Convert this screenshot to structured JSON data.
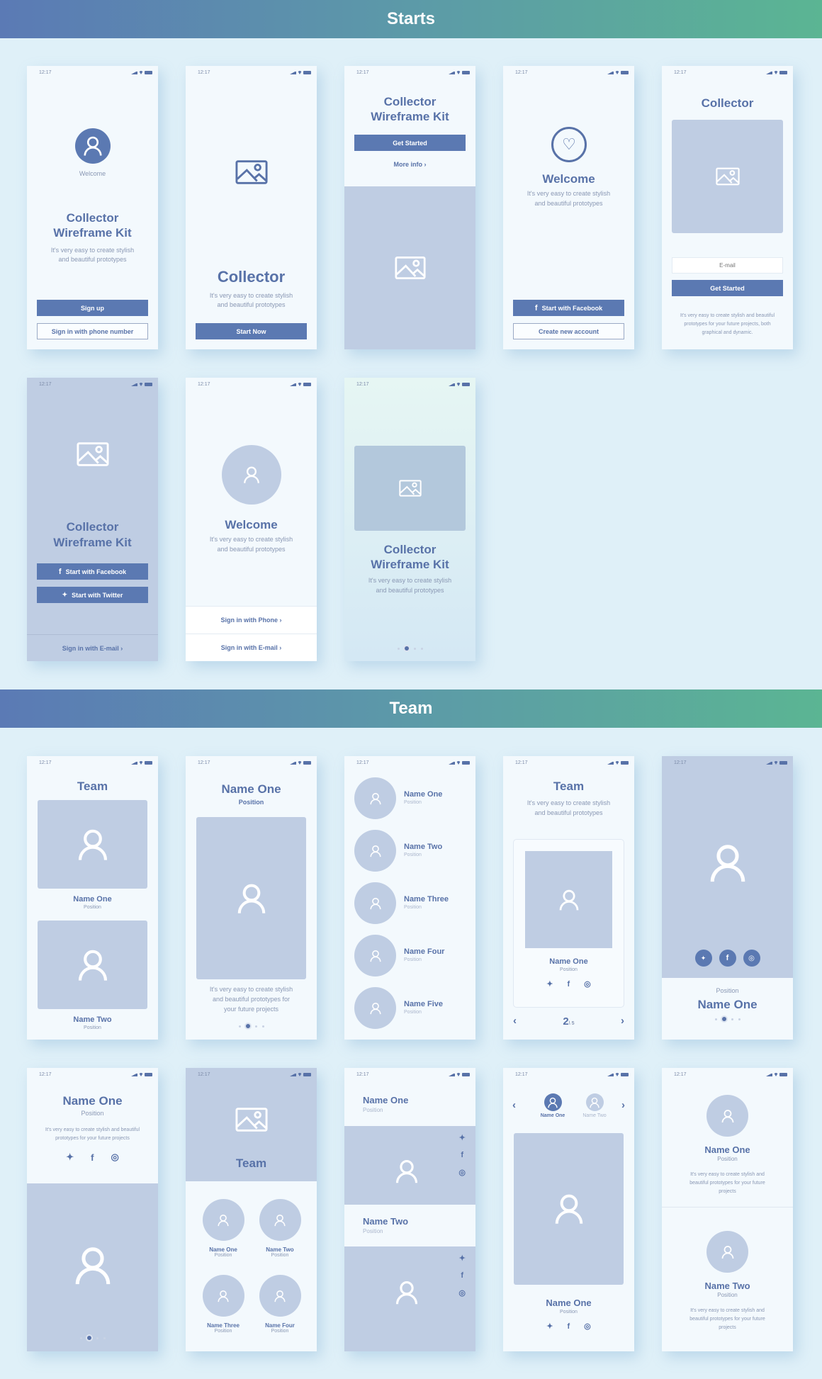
{
  "status_time": "12:17",
  "sections": {
    "starts": "Starts",
    "team": "Team"
  },
  "common": {
    "tagline": "It's very easy to create stylish and beautiful prototypes",
    "tagline_l1": "It's very easy to create stylish",
    "tagline_l2": "and beautiful prototypes",
    "collector": "Collector",
    "wk": "Wireframe Kit",
    "welcome": "Welcome",
    "position": "Position",
    "more_info": "More info",
    "get_started": "Get Started"
  },
  "s1": {
    "caption": "Welcome",
    "btn_signup": "Sign up",
    "btn_phone": "Sign in with phone number"
  },
  "s2": {
    "title": "Collector",
    "btn": "Start Now"
  },
  "s4": {
    "btn_fb": "Start with Facebook",
    "btn_create": "Create new account"
  },
  "s5": {
    "title": "Collector",
    "email_placeholder": "E-mail",
    "btn": "Get Started",
    "text_l1": "It's very easy to create stylish and beautiful",
    "text_l2": "prototypes for your future projects, both",
    "text_l3": "graphical and dynamic."
  },
  "s6": {
    "btn_fb": "Start with Facebook",
    "btn_tw": "Start with Twitter",
    "link": "Sign in with E-mail"
  },
  "s7": {
    "link_phone": "Sign in with Phone",
    "link_email": "Sign in with E-mail"
  },
  "carousel": {
    "active_index": 2,
    "total": 4
  },
  "team": {
    "t1": {
      "title": "Team",
      "members": [
        {
          "name": "Name One",
          "position": "Position"
        },
        {
          "name": "Name Two",
          "position": "Position"
        }
      ]
    },
    "t2": {
      "name": "Name One",
      "position": "Position",
      "text_l1": "It's very easy to create stylish",
      "text_l2": "and beautiful prototypes for",
      "text_l3": "your future projects"
    },
    "t3": {
      "members": [
        {
          "name": "Name One",
          "position": "Position"
        },
        {
          "name": "Name Two",
          "position": "Position"
        },
        {
          "name": "Name Three",
          "position": "Position"
        },
        {
          "name": "Name Four",
          "position": "Position"
        },
        {
          "name": "Name Five",
          "position": "Position"
        }
      ]
    },
    "t4": {
      "title": "Team",
      "name": "Name One",
      "position": "Position",
      "page": "2",
      "page_total": "\\ 5"
    },
    "t5": {
      "position": "Position",
      "name": "Name One"
    },
    "t6": {
      "name": "Name One",
      "position": "Position",
      "text_l1": "It's very easy to create stylish and beautiful",
      "text_l2": "prototypes for your future projects"
    },
    "t7": {
      "title": "Team",
      "members": [
        {
          "name": "Name One",
          "position": "Position"
        },
        {
          "name": "Name Two",
          "position": "Position"
        },
        {
          "name": "Name Three",
          "position": "Position"
        },
        {
          "name": "Name Four",
          "position": "Position"
        }
      ]
    },
    "t8": {
      "members": [
        {
          "name": "Name One",
          "position": "Position"
        },
        {
          "name": "Name Two",
          "position": "Position"
        }
      ]
    },
    "t9": {
      "tab1": "Name One",
      "tab2": "Name Two",
      "name": "Name One",
      "position": "Position"
    },
    "t10": {
      "members": [
        {
          "name": "Name One",
          "position": "Position"
        },
        {
          "name": "Name Two",
          "position": "Position"
        }
      ],
      "text_l1": "It's very easy to create stylish and",
      "text_l2": "beautiful prototypes for your future",
      "text_l3": "projects"
    }
  }
}
